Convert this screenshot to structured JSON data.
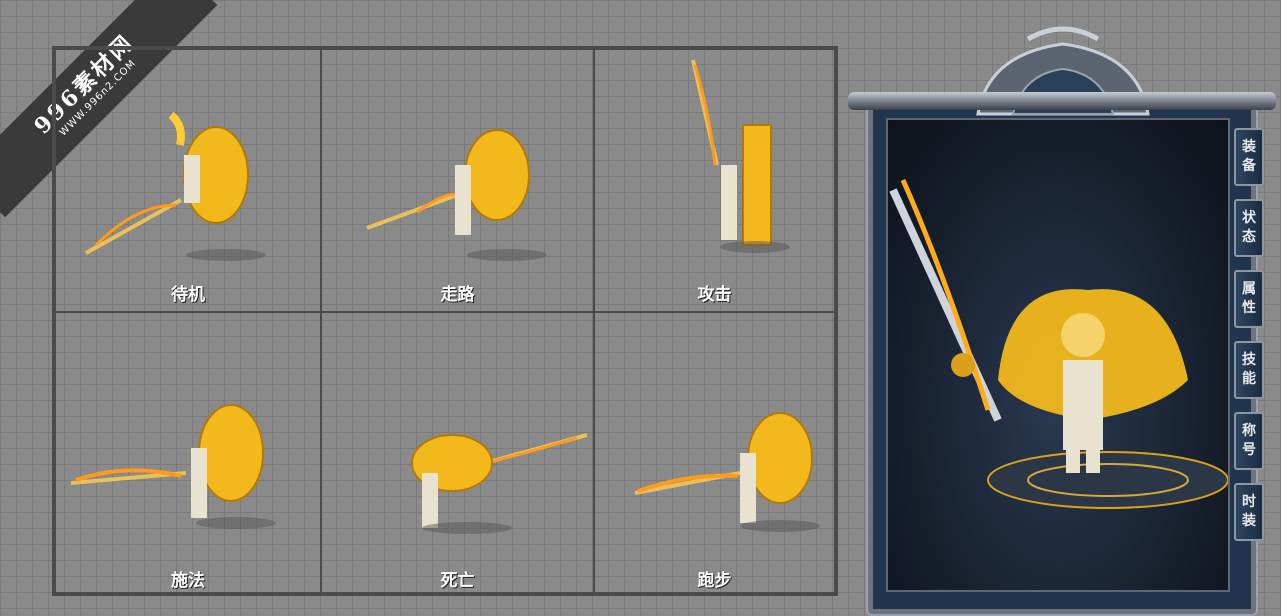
{
  "watermark": {
    "main": "996素材网",
    "sub": "WWW.996n2.COM"
  },
  "animations": [
    {
      "id": "idle",
      "label": "待机"
    },
    {
      "id": "walk",
      "label": "走路"
    },
    {
      "id": "attack",
      "label": "攻击"
    },
    {
      "id": "cast",
      "label": "施法"
    },
    {
      "id": "death",
      "label": "死亡"
    },
    {
      "id": "run",
      "label": "跑步"
    }
  ],
  "panel": {
    "tabs": [
      {
        "id": "equip",
        "label": "装\n备"
      },
      {
        "id": "status",
        "label": "状\n态"
      },
      {
        "id": "attrs",
        "label": "属\n性"
      },
      {
        "id": "skills",
        "label": "技\n能"
      },
      {
        "id": "title",
        "label": "称\n号"
      },
      {
        "id": "fashion",
        "label": "时\n装"
      }
    ]
  },
  "colors": {
    "gold": "#f2b81c",
    "flame": "#ff9a1a",
    "panel_bg": "#1f3550",
    "frame": "#6b7580"
  }
}
